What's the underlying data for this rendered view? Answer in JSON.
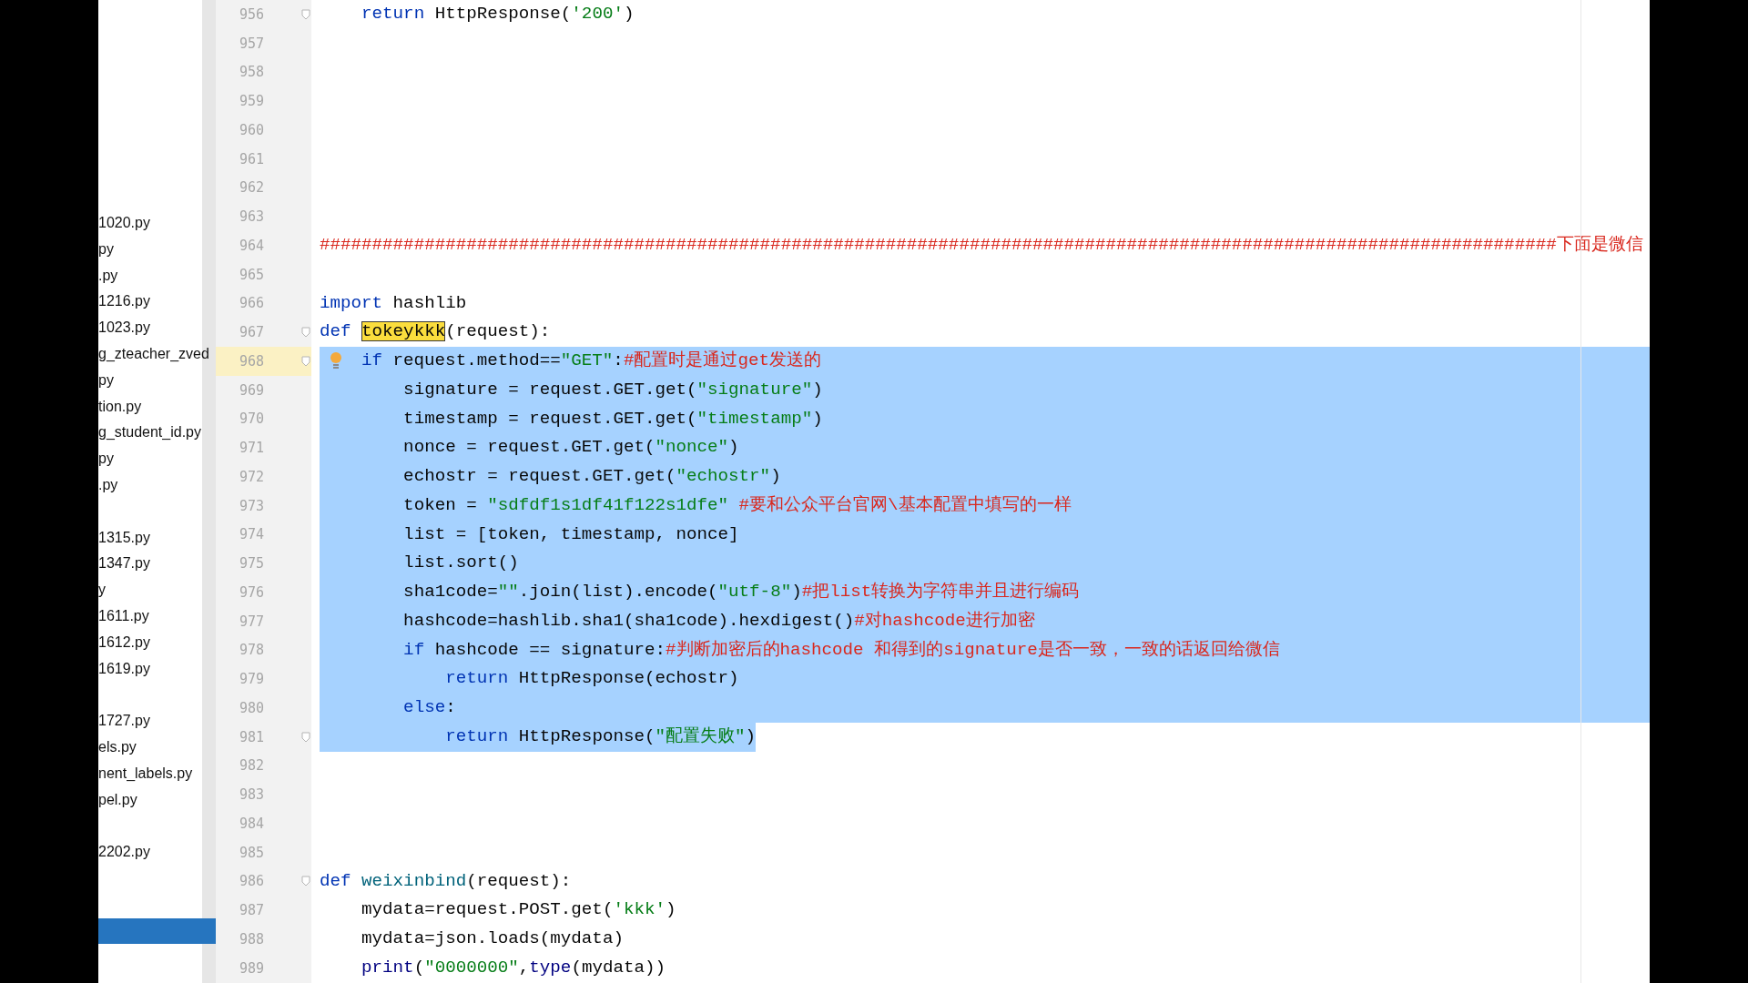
{
  "project_tree": {
    "items": [
      {
        "kind": "file",
        "text": "1020.py",
        "selected": false
      },
      {
        "kind": "file",
        "text": "py",
        "selected": false
      },
      {
        "kind": "file",
        "text": ".py",
        "selected": false
      },
      {
        "kind": "file",
        "text": "1216.py",
        "selected": false
      },
      {
        "kind": "file",
        "text": "1023.py",
        "selected": false
      },
      {
        "kind": "file",
        "text": "g_zteacher_zved",
        "selected": false
      },
      {
        "kind": "file",
        "text": "py",
        "selected": false
      },
      {
        "kind": "file",
        "text": "tion.py",
        "selected": false
      },
      {
        "kind": "file",
        "text": "g_student_id.py",
        "selected": false
      },
      {
        "kind": "file",
        "text": "py",
        "selected": false
      },
      {
        "kind": "file",
        "text": ".py",
        "selected": false
      },
      {
        "kind": "spacer",
        "selected": false
      },
      {
        "kind": "file",
        "text": "1315.py",
        "selected": false
      },
      {
        "kind": "file",
        "text": "1347.py",
        "selected": false
      },
      {
        "kind": "file",
        "text": "y",
        "selected": false
      },
      {
        "kind": "file",
        "text": "1611.py",
        "selected": false
      },
      {
        "kind": "file",
        "text": "1612.py",
        "selected": false
      },
      {
        "kind": "file",
        "text": "1619.py",
        "selected": false
      },
      {
        "kind": "spacer",
        "selected": false
      },
      {
        "kind": "file",
        "text": "1727.py",
        "selected": false
      },
      {
        "kind": "file",
        "text": "els.py",
        "selected": false
      },
      {
        "kind": "file",
        "text": "nent_labels.py",
        "selected": false
      },
      {
        "kind": "file",
        "text": "pel.py",
        "selected": false
      },
      {
        "kind": "spacer",
        "selected": false
      },
      {
        "kind": "file",
        "text": "2202.py",
        "selected": false
      },
      {
        "kind": "spacer",
        "selected": false
      },
      {
        "kind": "spacer",
        "selected": false
      },
      {
        "kind": "spacer",
        "selected": true
      }
    ]
  },
  "editor": {
    "lines": [
      {
        "number": "956",
        "fold": true,
        "segments": [
          {
            "kind": "keyword",
            "text": "    return"
          },
          {
            "kind": "plain",
            "text": " HttpResponse("
          },
          {
            "kind": "string",
            "text": "'200'"
          },
          {
            "kind": "plain",
            "text": ")"
          }
        ]
      },
      {
        "number": "957"
      },
      {
        "number": "958"
      },
      {
        "number": "959"
      },
      {
        "number": "960"
      },
      {
        "number": "961"
      },
      {
        "number": "962"
      },
      {
        "number": "963"
      },
      {
        "number": "964",
        "segments": [
          {
            "kind": "comment",
            "text": "######################################################################################################################下面是微信"
          }
        ]
      },
      {
        "number": "965"
      },
      {
        "number": "966",
        "segments": [
          {
            "kind": "keyword",
            "text": "import"
          },
          {
            "kind": "plain",
            "text": " hashlib"
          }
        ]
      },
      {
        "number": "967",
        "fold": true,
        "segments": [
          {
            "kind": "keyword",
            "text": "def "
          },
          {
            "kind": "match",
            "text": "tokeykkk"
          },
          {
            "kind": "plain",
            "text": "(request):"
          }
        ]
      },
      {
        "number": "968",
        "fold": true,
        "current": true,
        "bulb": true,
        "selected": true,
        "full_width": true,
        "segments": [
          {
            "kind": "keyword",
            "text": "if"
          },
          {
            "kind": "plain",
            "text": " request.method=="
          },
          {
            "kind": "string",
            "text": "\"GET\""
          },
          {
            "kind": "plain",
            "text": ":"
          },
          {
            "kind": "comment",
            "text": "#配置时是通过get发送的"
          }
        ]
      },
      {
        "number": "969",
        "selected": true,
        "full_width": true,
        "segments": [
          {
            "kind": "plain",
            "text": "        signature = request.GET.get("
          },
          {
            "kind": "string",
            "text": "\"signature\""
          },
          {
            "kind": "plain",
            "text": ")"
          }
        ]
      },
      {
        "number": "970",
        "selected": true,
        "full_width": true,
        "segments": [
          {
            "kind": "plain",
            "text": "        timestamp = request.GET.get("
          },
          {
            "kind": "string",
            "text": "\"timestamp\""
          },
          {
            "kind": "plain",
            "text": ")"
          }
        ]
      },
      {
        "number": "971",
        "selected": true,
        "full_width": true,
        "segments": [
          {
            "kind": "plain",
            "text": "        nonce = request.GET.get("
          },
          {
            "kind": "string",
            "text": "\"nonce\""
          },
          {
            "kind": "plain",
            "text": ")"
          }
        ]
      },
      {
        "number": "972",
        "selected": true,
        "full_width": true,
        "segments": [
          {
            "kind": "plain",
            "text": "        echostr = request.GET.get("
          },
          {
            "kind": "string",
            "text": "\"echostr\""
          },
          {
            "kind": "plain",
            "text": ")"
          }
        ]
      },
      {
        "number": "973",
        "selected": true,
        "full_width": true,
        "segments": [
          {
            "kind": "plain",
            "text": "        token = "
          },
          {
            "kind": "string",
            "text": "\"sdfdf1s1df41f122s1dfe\""
          },
          {
            "kind": "comment",
            "text": " #要和公众平台官网\\基本配置中填写的一样"
          }
        ]
      },
      {
        "number": "974",
        "selected": true,
        "full_width": true,
        "segments": [
          {
            "kind": "plain",
            "text": "        list = [token, timestamp, nonce]"
          }
        ]
      },
      {
        "number": "975",
        "selected": true,
        "full_width": true,
        "segments": [
          {
            "kind": "plain",
            "text": "        list.sort()"
          }
        ]
      },
      {
        "number": "976",
        "selected": true,
        "full_width": true,
        "segments": [
          {
            "kind": "plain",
            "text": "        sha1code="
          },
          {
            "kind": "string",
            "text": "\"\""
          },
          {
            "kind": "plain",
            "text": ".join(list).encode("
          },
          {
            "kind": "string",
            "text": "\"utf-8\""
          },
          {
            "kind": "plain",
            "text": ")"
          },
          {
            "kind": "comment",
            "text": "#把list转换为字符串并且进行编码"
          }
        ]
      },
      {
        "number": "977",
        "selected": true,
        "full_width": true,
        "segments": [
          {
            "kind": "plain",
            "text": "        hashcode=hashlib.sha1(sha1code).hexdigest()"
          },
          {
            "kind": "comment",
            "text": "#对hashcode进行加密"
          }
        ]
      },
      {
        "number": "978",
        "selected": true,
        "full_width": true,
        "segments": [
          {
            "kind": "keyword",
            "text": "        if"
          },
          {
            "kind": "plain",
            "text": " hashcode == signature:"
          },
          {
            "kind": "comment",
            "text": "#判断加密后的hashcode 和得到的signature是否一致，一致的话返回给微信"
          }
        ]
      },
      {
        "number": "979",
        "selected": true,
        "full_width": true,
        "segments": [
          {
            "kind": "keyword",
            "text": "            return"
          },
          {
            "kind": "plain",
            "text": " HttpResponse(echostr)"
          }
        ]
      },
      {
        "number": "980",
        "selected": true,
        "full_width": true,
        "segments": [
          {
            "kind": "keyword",
            "text": "        else"
          },
          {
            "kind": "plain",
            "text": ":"
          }
        ]
      },
      {
        "number": "981",
        "fold": true,
        "selected": true,
        "full_width": false,
        "segments": [
          {
            "kind": "keyword",
            "text": "            return"
          },
          {
            "kind": "plain",
            "text": " HttpResponse("
          },
          {
            "kind": "string",
            "text": "\"配置失败\""
          },
          {
            "kind": "plain",
            "text": ")"
          }
        ]
      },
      {
        "number": "982"
      },
      {
        "number": "983"
      },
      {
        "number": "984"
      },
      {
        "number": "985"
      },
      {
        "number": "986",
        "fold": true,
        "segments": [
          {
            "kind": "keyword",
            "text": "def "
          },
          {
            "kind": "function",
            "text": "weixinbind"
          },
          {
            "kind": "plain",
            "text": "(request):"
          }
        ]
      },
      {
        "number": "987",
        "segments": [
          {
            "kind": "plain",
            "text": "    mydata=request.POST.get("
          },
          {
            "kind": "string",
            "text": "'kkk'"
          },
          {
            "kind": "plain",
            "text": ")"
          }
        ]
      },
      {
        "number": "988",
        "segments": [
          {
            "kind": "plain",
            "text": "    mydata=json.loads(mydata)"
          }
        ]
      },
      {
        "number": "989",
        "segments": [
          {
            "kind": "builtin",
            "text": "    print"
          },
          {
            "kind": "plain",
            "text": "("
          },
          {
            "kind": "string",
            "text": "\"0000000\""
          },
          {
            "kind": "plain",
            "text": ","
          },
          {
            "kind": "builtin",
            "text": "type"
          },
          {
            "kind": "plain",
            "text": "(mydata))"
          }
        ]
      }
    ]
  }
}
